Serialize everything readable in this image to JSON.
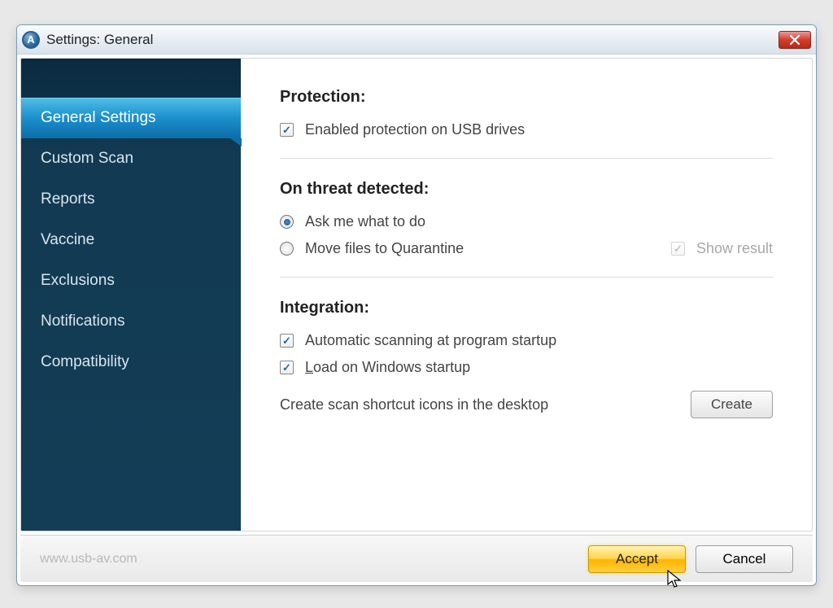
{
  "window": {
    "title": "Settings: General"
  },
  "sidebar": {
    "items": [
      {
        "label": "General Settings",
        "active": true
      },
      {
        "label": "Custom Scan",
        "active": false
      },
      {
        "label": "Reports",
        "active": false
      },
      {
        "label": "Vaccine",
        "active": false
      },
      {
        "label": "Exclusions",
        "active": false
      },
      {
        "label": "Notifications",
        "active": false
      },
      {
        "label": "Compatibility",
        "active": false
      }
    ]
  },
  "sections": {
    "protection": {
      "title": "Protection:",
      "usb_enabled_label": "Enabled protection on USB drives",
      "usb_enabled_checked": true
    },
    "threat": {
      "title": "On threat detected:",
      "ask_label": "Ask me what to do",
      "quarantine_label": "Move files to Quarantine",
      "selected": "ask",
      "show_result_label": "Show result",
      "show_result_checked": true,
      "show_result_disabled": true
    },
    "integration": {
      "title": "Integration:",
      "auto_scan_label": "Automatic scanning at program startup",
      "auto_scan_checked": true,
      "load_startup_label": "Load on Windows startup",
      "load_startup_checked": true,
      "shortcut_label": "Create scan shortcut icons in the desktop",
      "create_button": "Create"
    }
  },
  "footer": {
    "url": "www.usb-av.com",
    "accept": "Accept",
    "cancel": "Cancel"
  }
}
